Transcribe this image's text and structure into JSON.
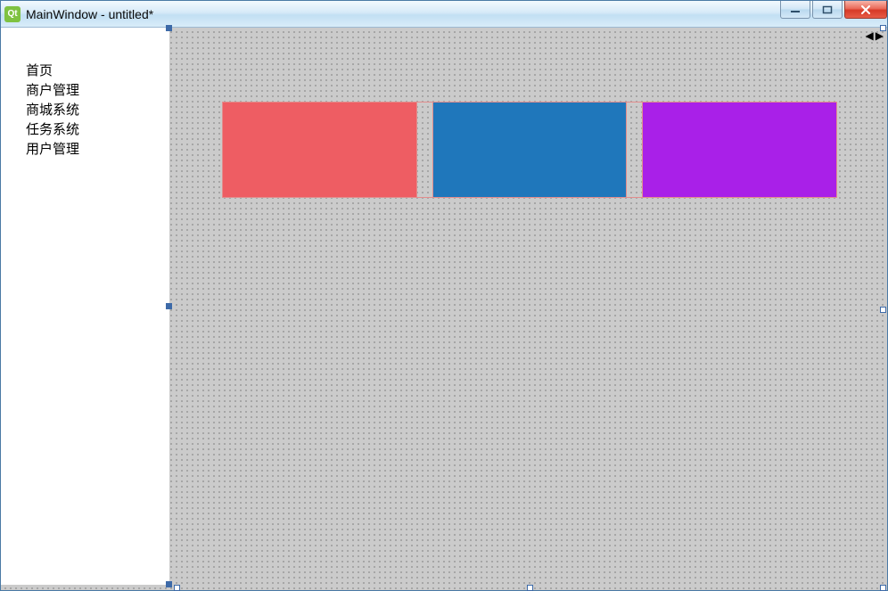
{
  "window": {
    "title": "MainWindow - untitled*",
    "qt_logo_text": "Qt"
  },
  "sidebar": {
    "items": [
      {
        "label": "首页"
      },
      {
        "label": "商户管理"
      },
      {
        "label": "商城系统"
      },
      {
        "label": "任务系统"
      },
      {
        "label": "用户管理"
      }
    ]
  },
  "blocks": [
    {
      "name": "block-red",
      "color": "#ee5d63"
    },
    {
      "name": "block-blue",
      "color": "#1f77bb"
    },
    {
      "name": "block-purple",
      "color": "#a920e8"
    }
  ],
  "nav": {
    "left": "◀",
    "right": "▶"
  }
}
